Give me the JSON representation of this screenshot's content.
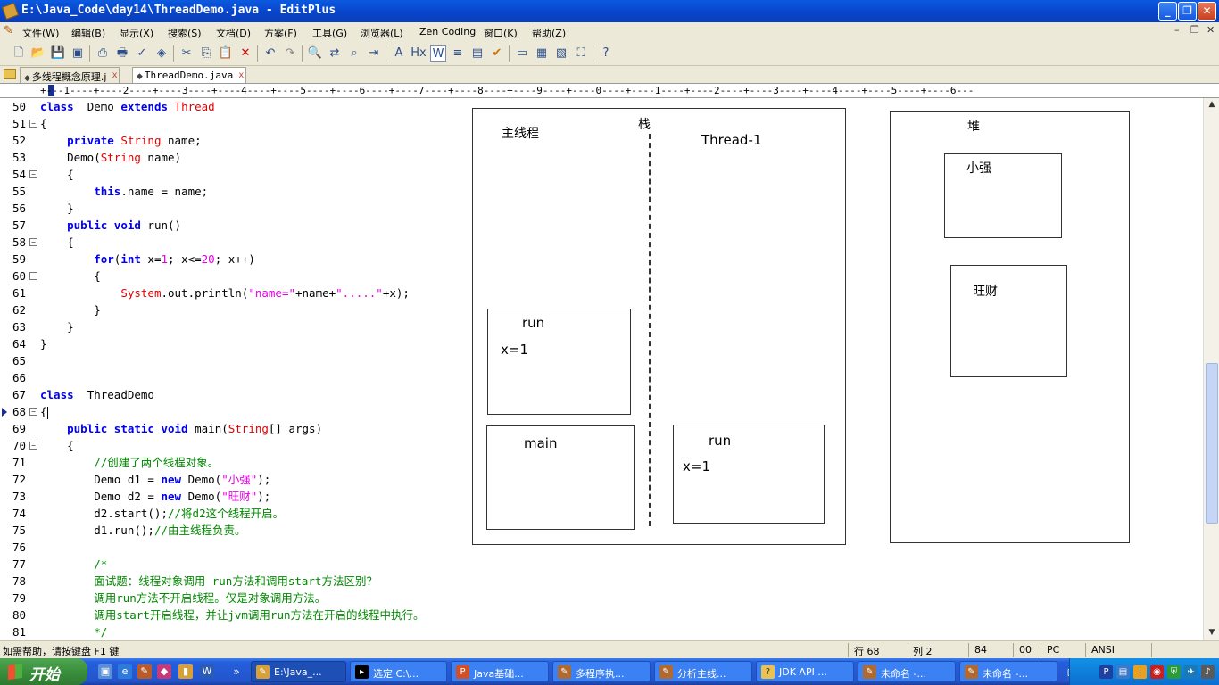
{
  "window": {
    "title": "E:\\Java_Code\\day14\\ThreadDemo.java - EditPlus",
    "buttons": [
      "minimize",
      "restore",
      "close"
    ]
  },
  "menu": {
    "items": [
      "文件(W)",
      "编辑(B)",
      "显示(X)",
      "搜索(S)",
      "文档(D)",
      "方案(F)",
      "工具(G)",
      "浏览器(L)",
      "Zen Coding",
      "窗口(K)",
      "帮助(Z)"
    ],
    "mdi_buttons": [
      "–",
      "❐",
      "✕"
    ]
  },
  "toolbar": {
    "icons": [
      "new-icon",
      "open-icon",
      "save-icon",
      "save-all-icon",
      "print-preview-icon",
      "print-icon",
      "spellcheck-icon",
      "browser-icon",
      "reload-icon",
      "cut-icon",
      "copy-icon",
      "paste-icon",
      "delete-icon",
      "undo-icon",
      "redo-icon",
      "find-icon",
      "replace-icon",
      "find-in-files-icon",
      "goto-icon",
      "font-icon",
      "hex-icon",
      "word-wrap-icon",
      "line-number-icon",
      "column-icon",
      "check-icon",
      "output-icon",
      "dir-icon",
      "cliptext-icon",
      "fullscreen-icon",
      "help-icon"
    ]
  },
  "tabs": [
    {
      "label": "多线程概念原理.j",
      "close": "x"
    },
    {
      "label": "ThreadDemo.java",
      "close": "x"
    }
  ],
  "ruler": "+---1----+----2----+----3----+----4----+----5----+----6----+----7----+----8----+----9----+----0----+----1----+----2----+----3----+----4----+----5----+----6---",
  "code_lines": [
    {
      "n": "50",
      "fold": "",
      "segs": [
        [
          "kw",
          "class"
        ],
        [
          "",
          "  Demo "
        ],
        [
          "kw",
          "extends"
        ],
        [
          "",
          " "
        ],
        [
          "ty",
          "Thread"
        ]
      ]
    },
    {
      "n": "51",
      "fold": "⊟",
      "segs": [
        [
          "",
          "{"
        ]
      ]
    },
    {
      "n": "52",
      "fold": "",
      "segs": [
        [
          "",
          "    "
        ],
        [
          "kw",
          "private"
        ],
        [
          "",
          " "
        ],
        [
          "ty",
          "String"
        ],
        [
          "",
          " name;"
        ]
      ]
    },
    {
      "n": "53",
      "fold": "",
      "segs": [
        [
          "",
          "    Demo("
        ],
        [
          "ty",
          "String"
        ],
        [
          "",
          " name)"
        ]
      ]
    },
    {
      "n": "54",
      "fold": "⊟",
      "segs": [
        [
          "",
          "    {"
        ]
      ]
    },
    {
      "n": "55",
      "fold": "",
      "segs": [
        [
          "",
          "        "
        ],
        [
          "kw",
          "this"
        ],
        [
          "",
          ".name = name;"
        ]
      ]
    },
    {
      "n": "56",
      "fold": "",
      "segs": [
        [
          "",
          "    }"
        ]
      ]
    },
    {
      "n": "57",
      "fold": "",
      "segs": [
        [
          "",
          "    "
        ],
        [
          "kw",
          "public"
        ],
        [
          "",
          " "
        ],
        [
          "kw",
          "void"
        ],
        [
          "",
          " run()"
        ]
      ]
    },
    {
      "n": "58",
      "fold": "⊟",
      "segs": [
        [
          "",
          "    {"
        ]
      ]
    },
    {
      "n": "59",
      "fold": "",
      "segs": [
        [
          "",
          "        "
        ],
        [
          "kw",
          "for"
        ],
        [
          "",
          "("
        ],
        [
          "kw",
          "int"
        ],
        [
          "",
          " x="
        ],
        [
          "nm",
          "1"
        ],
        [
          "",
          "; x<="
        ],
        [
          "nm",
          "20"
        ],
        [
          "",
          "; x++)"
        ]
      ]
    },
    {
      "n": "60",
      "fold": "⊟",
      "segs": [
        [
          "",
          "        {"
        ]
      ]
    },
    {
      "n": "61",
      "fold": "",
      "segs": [
        [
          "",
          "            "
        ],
        [
          "ty",
          "System"
        ],
        [
          "",
          ".out.println("
        ],
        [
          "st",
          "\"name=\""
        ],
        [
          "",
          "+name+"
        ],
        [
          "st",
          "\".....\""
        ],
        [
          "",
          "+x);"
        ]
      ]
    },
    {
      "n": "62",
      "fold": "",
      "segs": [
        [
          "",
          "        }"
        ]
      ]
    },
    {
      "n": "63",
      "fold": "",
      "segs": [
        [
          "",
          "    }"
        ]
      ]
    },
    {
      "n": "64",
      "fold": "",
      "segs": [
        [
          "",
          "}"
        ]
      ]
    },
    {
      "n": "65",
      "fold": "",
      "segs": [
        [
          "",
          ""
        ]
      ]
    },
    {
      "n": "66",
      "fold": "",
      "segs": [
        [
          "",
          ""
        ]
      ]
    },
    {
      "n": "67",
      "fold": "",
      "segs": [
        [
          "kw",
          "class"
        ],
        [
          "",
          "  ThreadDemo"
        ]
      ]
    },
    {
      "n": "68",
      "fold": "⊟",
      "segs": [
        [
          "",
          "{"
        ]
      ],
      "current": true
    },
    {
      "n": "69",
      "fold": "",
      "segs": [
        [
          "",
          "    "
        ],
        [
          "kw",
          "public"
        ],
        [
          "",
          " "
        ],
        [
          "kw",
          "static"
        ],
        [
          "",
          " "
        ],
        [
          "kw",
          "void"
        ],
        [
          "",
          " main("
        ],
        [
          "ty",
          "String"
        ],
        [
          "",
          "[] args)"
        ]
      ]
    },
    {
      "n": "70",
      "fold": "⊟",
      "segs": [
        [
          "",
          "    {"
        ]
      ]
    },
    {
      "n": "71",
      "fold": "",
      "segs": [
        [
          "",
          "        "
        ],
        [
          "cm",
          "//创建了两个线程对象。"
        ]
      ]
    },
    {
      "n": "72",
      "fold": "",
      "segs": [
        [
          "",
          "        Demo d1 = "
        ],
        [
          "kw",
          "new"
        ],
        [
          "",
          " Demo("
        ],
        [
          "st",
          "\"小强\""
        ],
        [
          "",
          ");"
        ]
      ]
    },
    {
      "n": "73",
      "fold": "",
      "segs": [
        [
          "",
          "        Demo d2 = "
        ],
        [
          "kw",
          "new"
        ],
        [
          "",
          " Demo("
        ],
        [
          "st",
          "\"旺财\""
        ],
        [
          "",
          ");"
        ]
      ]
    },
    {
      "n": "74",
      "fold": "",
      "segs": [
        [
          "",
          "        d2.start();"
        ],
        [
          "cm",
          "//将d2这个线程开启。"
        ]
      ]
    },
    {
      "n": "75",
      "fold": "",
      "segs": [
        [
          "",
          "        d1.run();"
        ],
        [
          "cm",
          "//由主线程负责。"
        ]
      ]
    },
    {
      "n": "76",
      "fold": "",
      "segs": [
        [
          "",
          ""
        ]
      ]
    },
    {
      "n": "77",
      "fold": "",
      "segs": [
        [
          "",
          "        "
        ],
        [
          "cm",
          "/*"
        ]
      ]
    },
    {
      "n": "78",
      "fold": "",
      "segs": [
        [
          "",
          "        "
        ],
        [
          "cm",
          "面试题：线程对象调用 run方法和调用start方法区别？"
        ]
      ]
    },
    {
      "n": "79",
      "fold": "",
      "segs": [
        [
          "",
          "        "
        ],
        [
          "cm",
          "调用run方法不开启线程。仅是对象调用方法。"
        ]
      ]
    },
    {
      "n": "80",
      "fold": "",
      "segs": [
        [
          "",
          "        "
        ],
        [
          "cm",
          "调用start开启线程，并让jvm调用run方法在开启的线程中执行。"
        ]
      ]
    },
    {
      "n": "81",
      "fold": "",
      "segs": [
        [
          "",
          "        "
        ],
        [
          "cm",
          "*/"
        ]
      ]
    }
  ],
  "diagram": {
    "stack_label": "栈",
    "main_thread_label": "主线程",
    "thread1_label": "Thread-1",
    "heap_label": "堆",
    "frame_run_main": {
      "title": "run",
      "var": "x=1"
    },
    "frame_main": {
      "title": "main"
    },
    "frame_run_t1": {
      "title": "run",
      "var": "x=1"
    },
    "obj1": "小强",
    "obj2": "旺财"
  },
  "status": {
    "help": "如需帮助，请按键盘 F1 键",
    "row": "行 68",
    "col": "列 2",
    "chars": "84",
    "code": "00",
    "mode": "PC",
    "encoding": "ANSI"
  },
  "taskbar": {
    "start": "开始",
    "tasks": [
      {
        "label": "E:\\Java_...",
        "active": true,
        "icon": "editplus-icon"
      },
      {
        "label": "选定 C:\\...",
        "active": false,
        "icon": "cmd-icon"
      },
      {
        "label": "Java基础...",
        "active": false,
        "icon": "ppt-icon"
      },
      {
        "label": "多程序执...",
        "active": false,
        "icon": "paint-icon"
      },
      {
        "label": "分析主线...",
        "active": false,
        "icon": "paint-icon"
      },
      {
        "label": "JDK API ...",
        "active": false,
        "icon": "help-icon"
      },
      {
        "label": "未命名 -...",
        "active": false,
        "icon": "paint-icon"
      },
      {
        "label": "未命名 -...",
        "active": false,
        "icon": "paint-icon"
      }
    ]
  }
}
